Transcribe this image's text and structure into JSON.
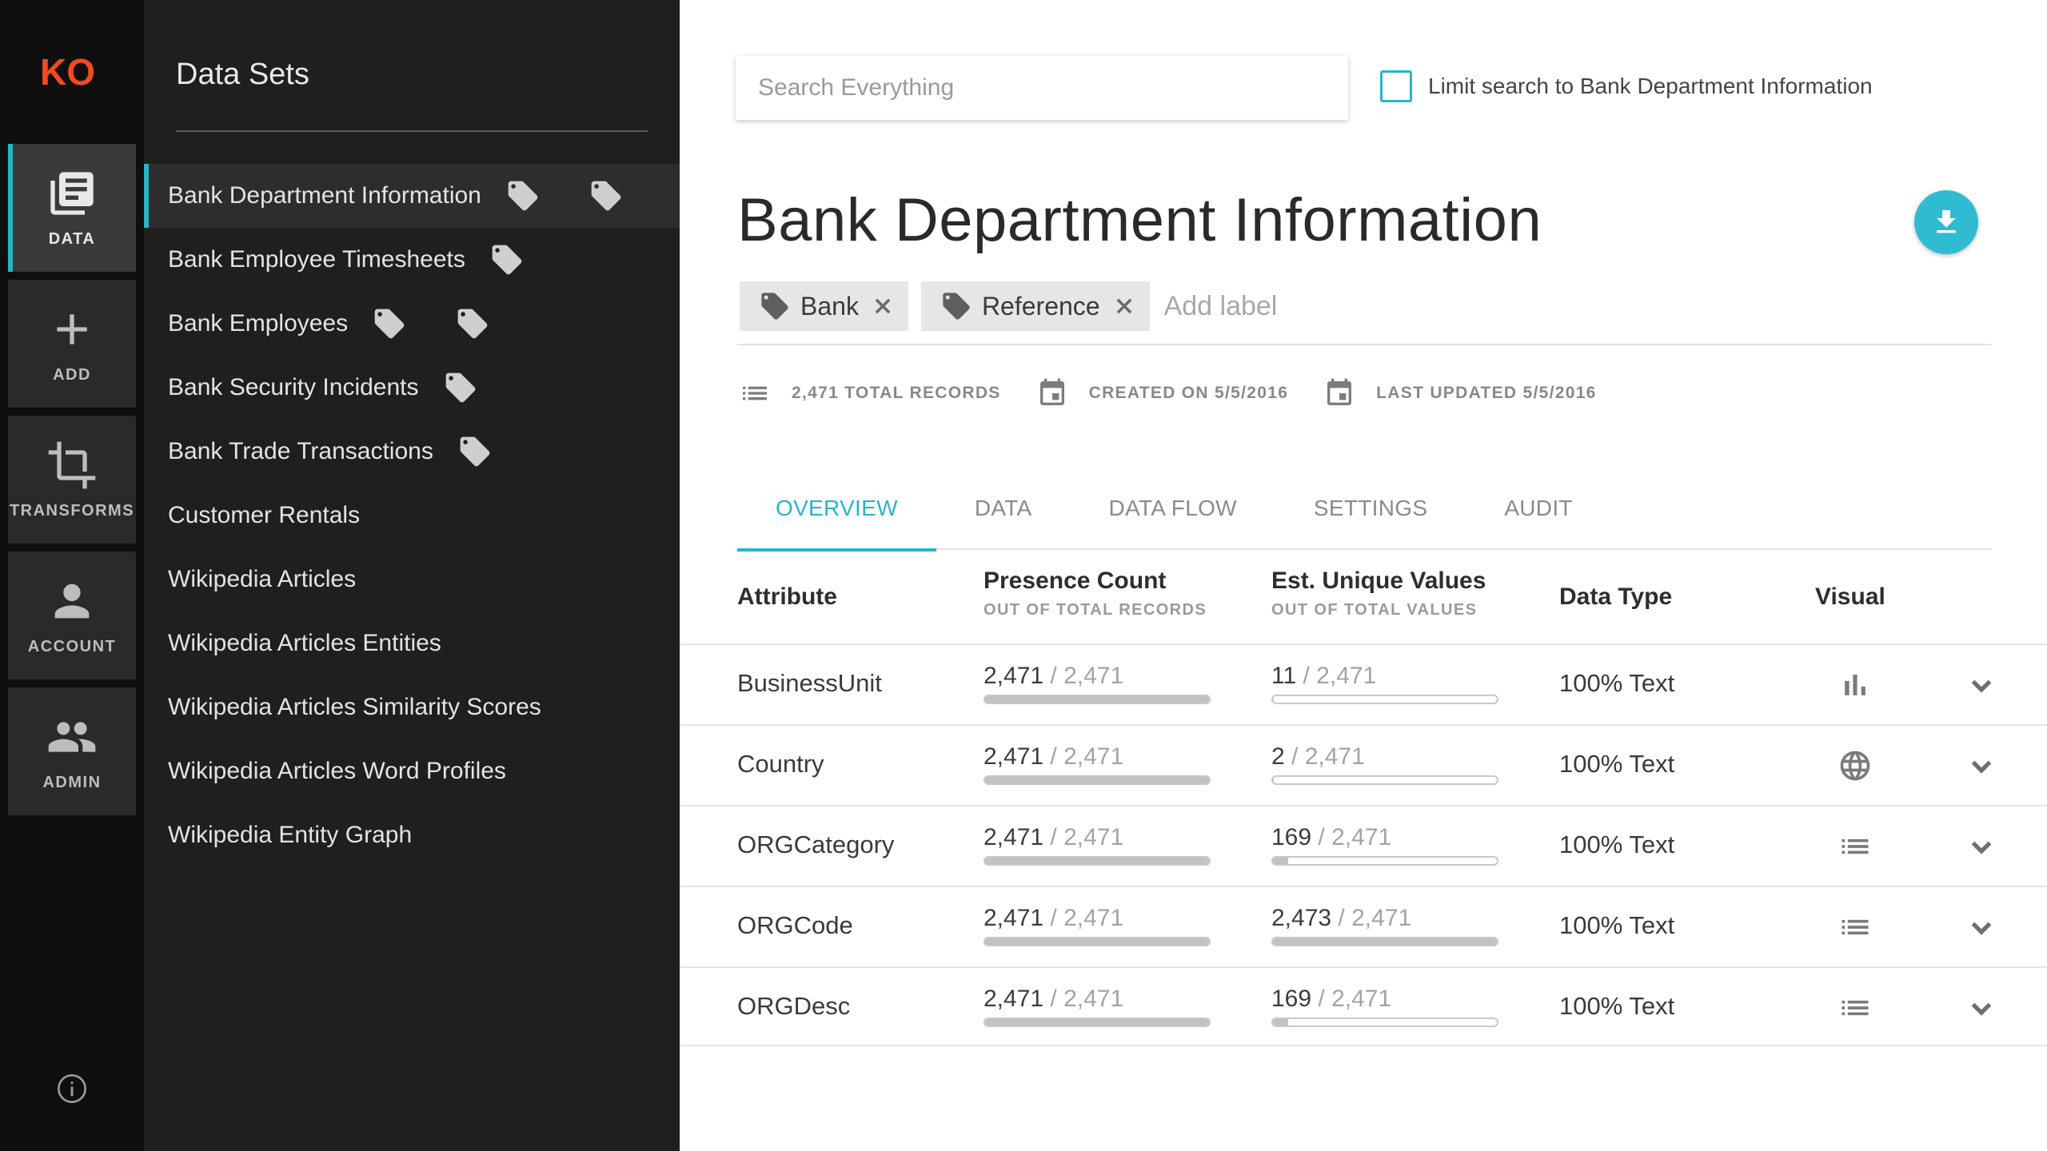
{
  "app": {
    "logo_text": "KO",
    "nav": [
      {
        "label": "DATA",
        "icon": "library-books-icon",
        "active": true
      },
      {
        "label": "ADD",
        "icon": "plus-icon",
        "active": false
      },
      {
        "label": "TRANSFORMS",
        "icon": "crop-transform-icon",
        "active": false
      },
      {
        "label": "ACCOUNT",
        "icon": "person-icon",
        "active": false
      },
      {
        "label": "ADMIN",
        "icon": "people-icon",
        "active": false
      }
    ],
    "info_icon": "info-icon",
    "accent_color": "#2ab4c9",
    "logo_color": "#f04a23"
  },
  "sidebar": {
    "title": "Data Sets",
    "items": [
      {
        "label": "Bank Department Information",
        "tags": 2,
        "selected": true
      },
      {
        "label": "Bank Employee Timesheets",
        "tags": 1
      },
      {
        "label": "Bank Employees",
        "tags": 2
      },
      {
        "label": "Bank Security Incidents",
        "tags": 1
      },
      {
        "label": "Bank Trade Transactions",
        "tags": 1
      },
      {
        "label": "Customer Rentals",
        "tags": 0
      },
      {
        "label": "Wikipedia Articles",
        "tags": 0
      },
      {
        "label": "Wikipedia Articles Entities",
        "tags": 0
      },
      {
        "label": "Wikipedia Articles Similarity Scores",
        "tags": 0
      },
      {
        "label": "Wikipedia Articles Word Profiles",
        "tags": 0
      },
      {
        "label": "Wikipedia Entity Graph",
        "tags": 0
      }
    ]
  },
  "search": {
    "placeholder": "Search Everything",
    "value": "",
    "limit_label": "Limit search to Bank Department Information",
    "limit_checked": false
  },
  "dataset": {
    "title": "Bank Department Information",
    "labels": [
      "Bank",
      "Reference"
    ],
    "add_label_placeholder": "Add label",
    "meta": {
      "records": "2,471 TOTAL RECORDS",
      "created": "CREATED ON 5/5/2016",
      "updated": "LAST UPDATED 5/5/2016"
    }
  },
  "tabs": [
    {
      "label": "OVERVIEW",
      "active": true
    },
    {
      "label": "DATA",
      "active": false
    },
    {
      "label": "DATA FLOW",
      "active": false
    },
    {
      "label": "SETTINGS",
      "active": false
    },
    {
      "label": "AUDIT",
      "active": false
    }
  ],
  "table": {
    "headers": {
      "attribute": "Attribute",
      "presence": "Presence Count",
      "presence_sub": "OUT OF TOTAL RECORDS",
      "unique": "Est. Unique Values",
      "unique_sub": "OUT OF TOTAL VALUES",
      "datatype": "Data Type",
      "visual": "Visual"
    },
    "rows": [
      {
        "attribute": "BusinessUnit",
        "presence": "2,471",
        "presence_total": "/ 2,471",
        "presence_frac": 1.0,
        "unique": "11",
        "unique_total": "/ 2,471",
        "unique_frac": 0.0045,
        "type": "100% Text",
        "visual_icon": "bar-chart-icon"
      },
      {
        "attribute": "Country",
        "presence": "2,471",
        "presence_total": "/ 2,471",
        "presence_frac": 1.0,
        "unique": "2",
        "unique_total": "/ 2,471",
        "unique_frac": 0.0008,
        "type": "100% Text",
        "visual_icon": "globe-icon"
      },
      {
        "attribute": "ORGCategory",
        "presence": "2,471",
        "presence_total": "/ 2,471",
        "presence_frac": 1.0,
        "unique": "169",
        "unique_total": "/ 2,471",
        "unique_frac": 0.068,
        "type": "100% Text",
        "visual_icon": "list-icon"
      },
      {
        "attribute": "ORGCode",
        "presence": "2,471",
        "presence_total": "/ 2,471",
        "presence_frac": 1.0,
        "unique": "2,473",
        "unique_total": "/ 2,471",
        "unique_frac": 1.0,
        "type": "100% Text",
        "visual_icon": "list-icon"
      },
      {
        "attribute": "ORGDesc",
        "presence": "2,471",
        "presence_total": "/ 2,471",
        "presence_frac": 1.0,
        "unique": "169",
        "unique_total": "/ 2,471",
        "unique_frac": 0.068,
        "type": "100% Text",
        "visual_icon": "list-icon"
      }
    ]
  }
}
